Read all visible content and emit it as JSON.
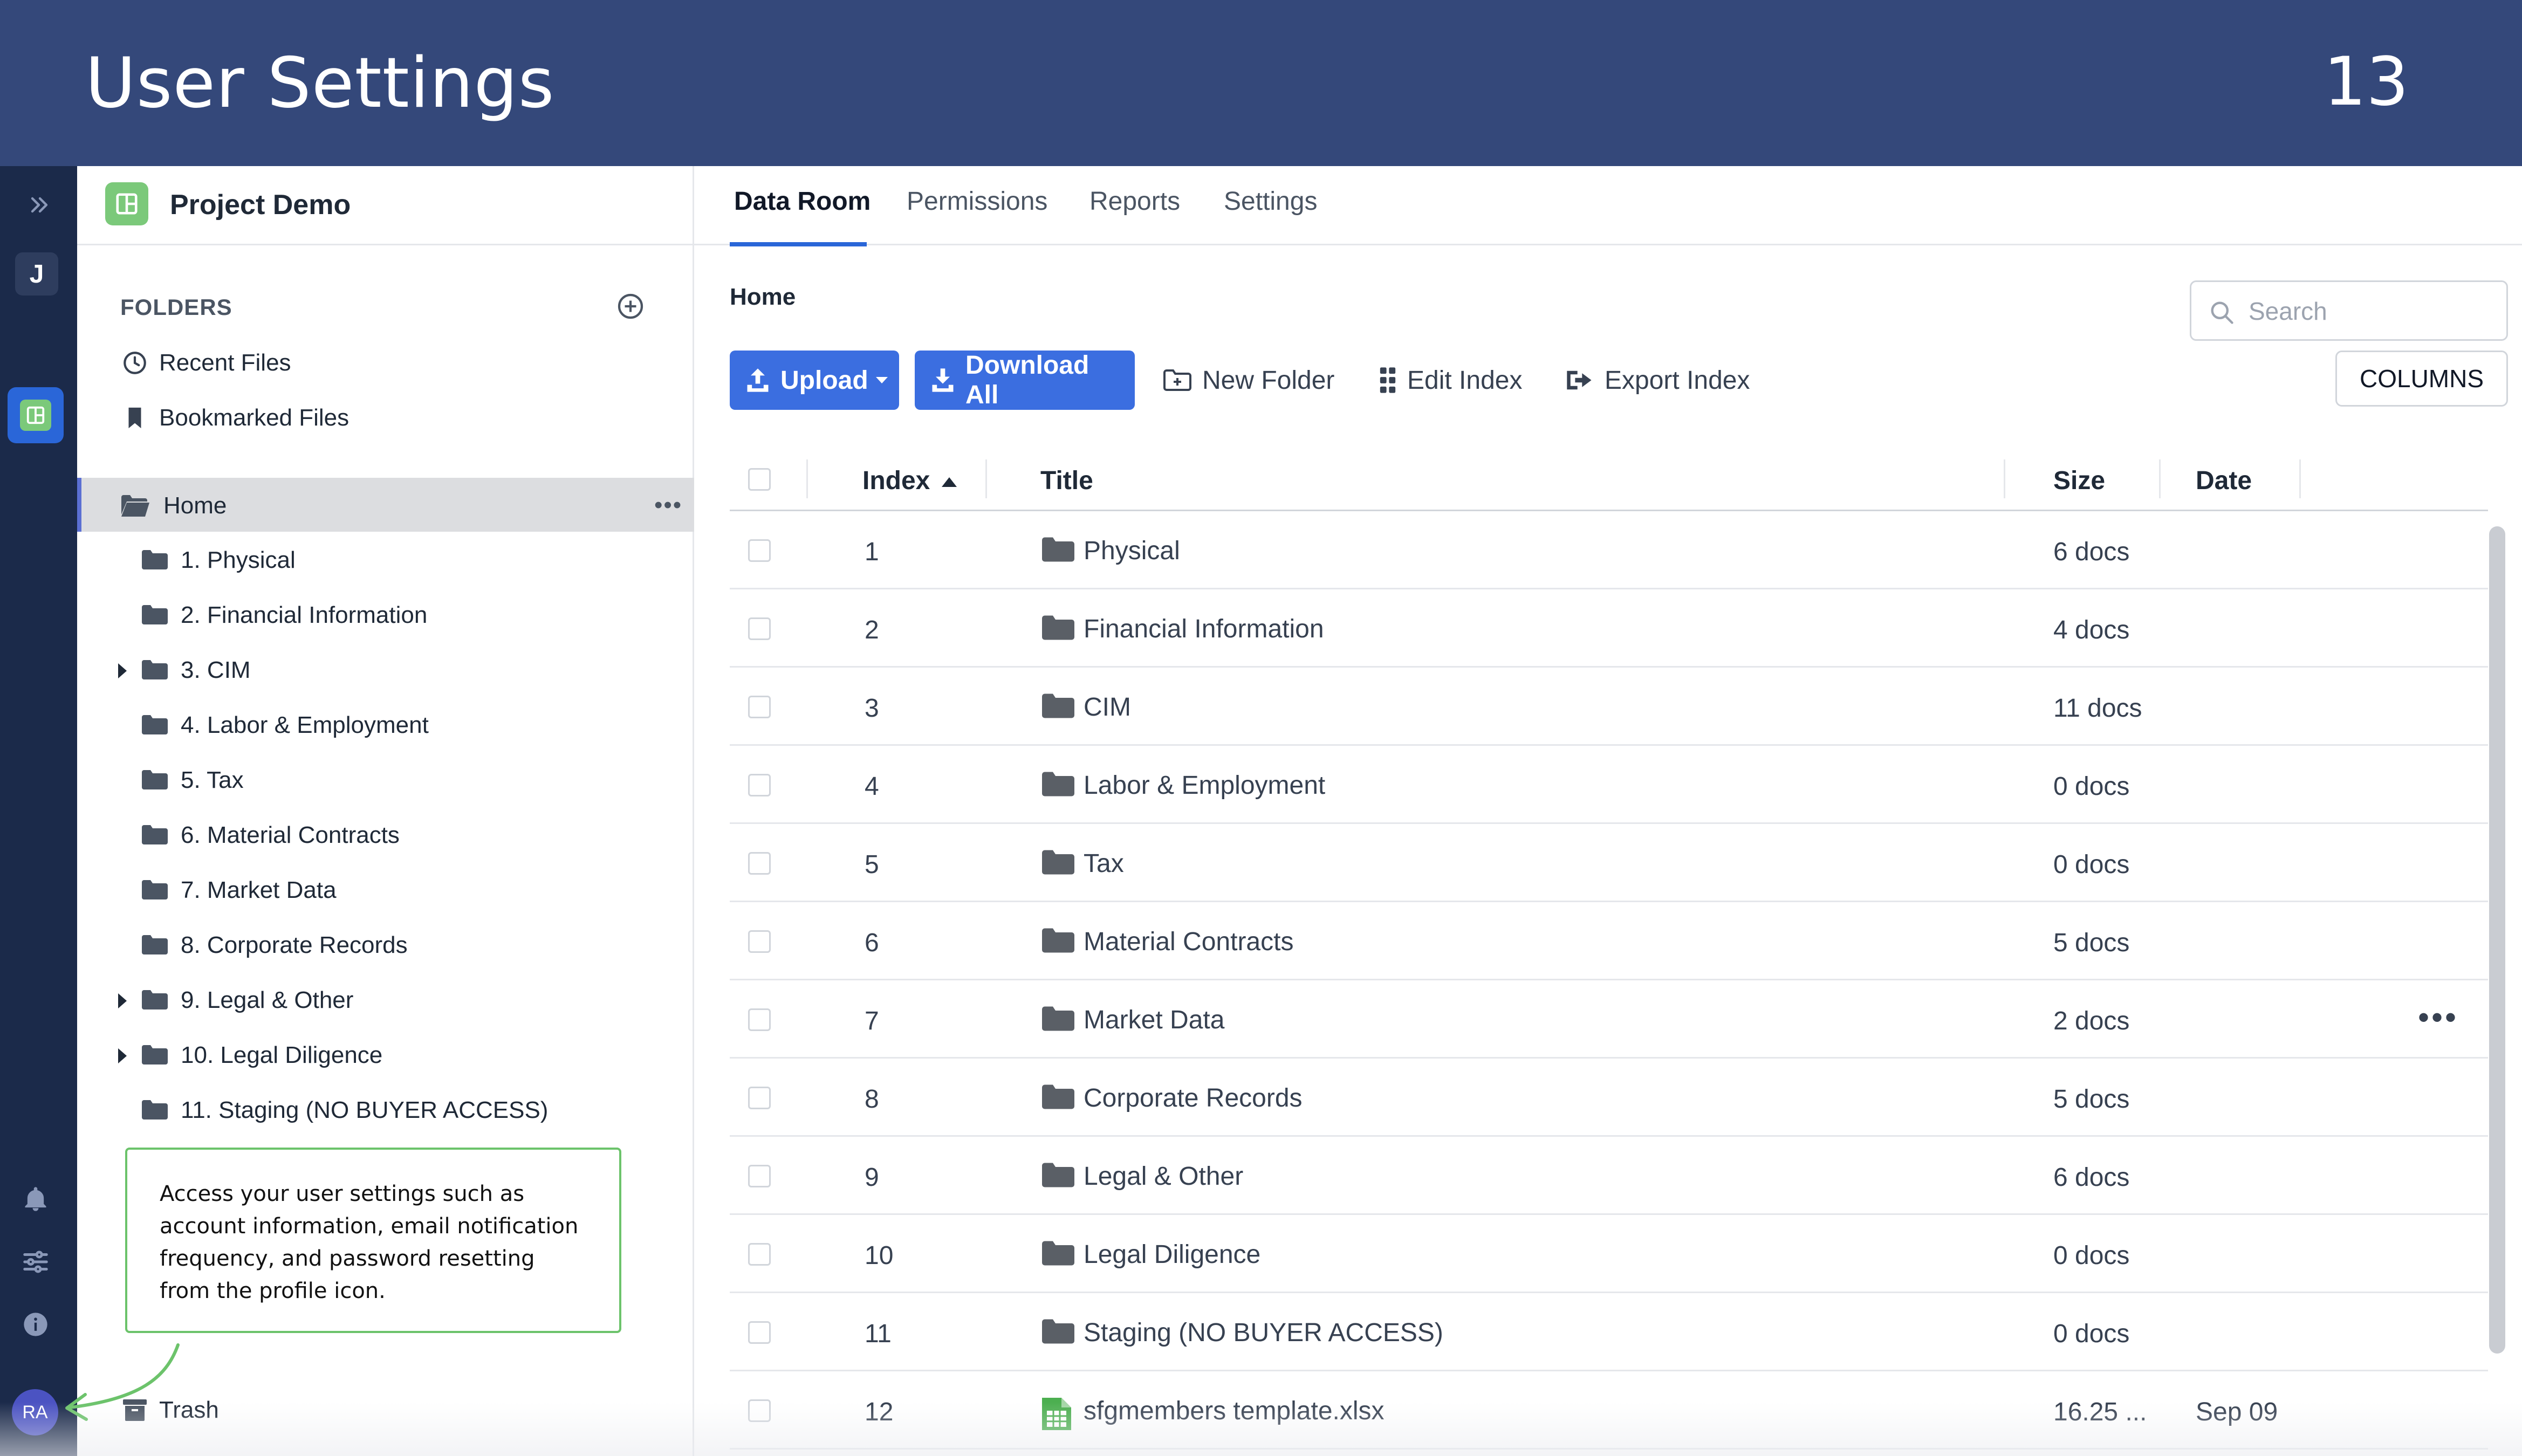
{
  "banner": {
    "title": "User Settings",
    "page_number": "13"
  },
  "rail": {
    "expand_icon": "double-chevron-right-icon",
    "workspace_initial": "J",
    "avatar_initials": "RA"
  },
  "sidebar": {
    "project_name": "Project Demo",
    "folders_label": "FOLDERS",
    "quick_links": [
      {
        "label": "Recent Files",
        "icon": "clock-icon"
      },
      {
        "label": "Bookmarked Files",
        "icon": "bookmark-icon"
      }
    ],
    "home_label": "Home",
    "home_more": "•••",
    "tree": [
      {
        "label": "1. Physical",
        "expandable": false
      },
      {
        "label": "2. Financial Information",
        "expandable": false
      },
      {
        "label": "3. CIM",
        "expandable": true
      },
      {
        "label": "4. Labor & Employment",
        "expandable": false
      },
      {
        "label": "5. Tax",
        "expandable": false
      },
      {
        "label": "6. Material Contracts",
        "expandable": false
      },
      {
        "label": "7. Market Data",
        "expandable": false
      },
      {
        "label": "8. Corporate Records",
        "expandable": false
      },
      {
        "label": "9. Legal & Other",
        "expandable": true
      },
      {
        "label": "10. Legal Diligence",
        "expandable": true
      },
      {
        "label": "11. Staging (NO BUYER ACCESS)",
        "expandable": false
      }
    ],
    "trash_label": "Trash"
  },
  "callout": {
    "text": "Access your user settings such as account information, email notification frequency, and password resetting from the profile icon."
  },
  "tabs": [
    {
      "label": "Data Room",
      "active": true
    },
    {
      "label": "Permissions",
      "active": false
    },
    {
      "label": "Reports",
      "active": false
    },
    {
      "label": "Settings",
      "active": false
    }
  ],
  "main": {
    "breadcrumb": "Home",
    "search_placeholder": "Search",
    "columns_label": "COLUMNS",
    "toolbar": {
      "upload_label": "Upload",
      "download_all_label": "Download All",
      "new_folder_label": "New Folder",
      "edit_index_label": "Edit Index",
      "export_index_label": "Export Index"
    },
    "table": {
      "headers": {
        "index": "Index",
        "title": "Title",
        "size": "Size",
        "date": "Date"
      },
      "rows": [
        {
          "index": "1",
          "title": "Physical",
          "size": "6 docs",
          "date": "",
          "type": "folder"
        },
        {
          "index": "2",
          "title": "Financial Information",
          "size": "4 docs",
          "date": "",
          "type": "folder"
        },
        {
          "index": "3",
          "title": "CIM",
          "size": "11 docs",
          "date": "",
          "type": "folder"
        },
        {
          "index": "4",
          "title": "Labor & Employment",
          "size": "0 docs",
          "date": "",
          "type": "folder"
        },
        {
          "index": "5",
          "title": "Tax",
          "size": "0 docs",
          "date": "",
          "type": "folder"
        },
        {
          "index": "6",
          "title": "Material Contracts",
          "size": "5 docs",
          "date": "",
          "type": "folder"
        },
        {
          "index": "7",
          "title": "Market Data",
          "size": "2 docs",
          "date": "",
          "type": "folder",
          "more": "•••"
        },
        {
          "index": "8",
          "title": "Corporate Records",
          "size": "5 docs",
          "date": "",
          "type": "folder"
        },
        {
          "index": "9",
          "title": "Legal & Other",
          "size": "6 docs",
          "date": "",
          "type": "folder"
        },
        {
          "index": "10",
          "title": "Legal Diligence",
          "size": "0 docs",
          "date": "",
          "type": "folder"
        },
        {
          "index": "11",
          "title": "Staging (NO BUYER ACCESS)",
          "size": "0 docs",
          "date": "",
          "type": "folder"
        },
        {
          "index": "12",
          "title": "sfgmembers template.xlsx",
          "size": "16.25 ...",
          "date": "Sep 09",
          "type": "spreadsheet"
        }
      ]
    }
  },
  "colors": {
    "banner": "#34487a",
    "rail": "#1b2a4a",
    "primary": "#3b6ee0",
    "accent_green": "#7bc97a",
    "callout_border": "#6cc36b",
    "avatar": "#4b53c2"
  }
}
